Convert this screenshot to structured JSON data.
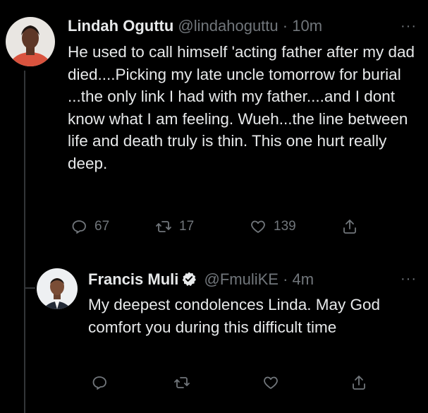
{
  "tweets": [
    {
      "name": "Lindah Oguttu",
      "handle": "@lindahoguttu",
      "separator": "·",
      "time": "10m",
      "text": "He used to call himself 'acting father after my dad died....Picking my late uncle tomorrow for burial ...the only link I had with my father....and I dont know what I am feeling.  Wueh...the line between life and death truly is thin. This one hurt really deep.",
      "replies": "67",
      "retweets": "17",
      "likes": "139",
      "more_label": "···"
    },
    {
      "name": "Francis Muli",
      "handle": "@FmuliKE",
      "separator": "·",
      "time": "4m",
      "text": "My deepest condolences Linda. May God comfort you during this difficult time",
      "replies": "",
      "retweets": "",
      "likes": "",
      "more_label": "···",
      "verified": true
    }
  ],
  "icons": {
    "reply": "reply-icon",
    "retweet": "retweet-icon",
    "like": "heart-icon",
    "share": "share-icon",
    "verified": "verified-badge-icon"
  },
  "colors": {
    "background": "#000000",
    "text": "#e7e9ea",
    "muted": "#71767b",
    "verified": "#e7e9ea"
  }
}
